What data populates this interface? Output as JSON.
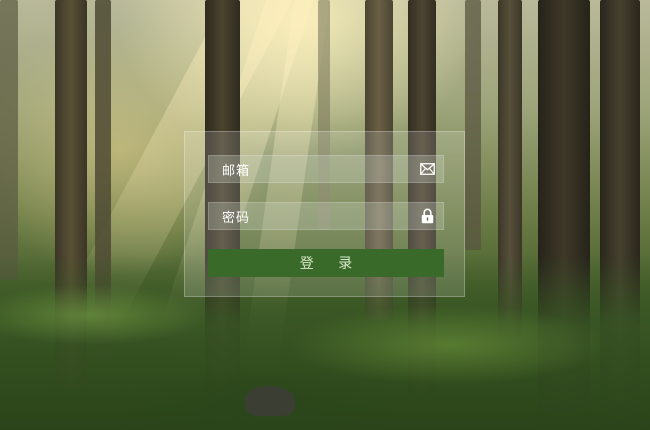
{
  "login": {
    "email_label": "邮箱",
    "password_label": "密码",
    "submit_label": "登 录",
    "email_icon": "mail-icon",
    "password_icon": "lock-icon"
  },
  "colors": {
    "button": "#3a6a2a",
    "button_text": "#d9e8c9",
    "panel": "rgba(255,255,255,0.15)"
  }
}
